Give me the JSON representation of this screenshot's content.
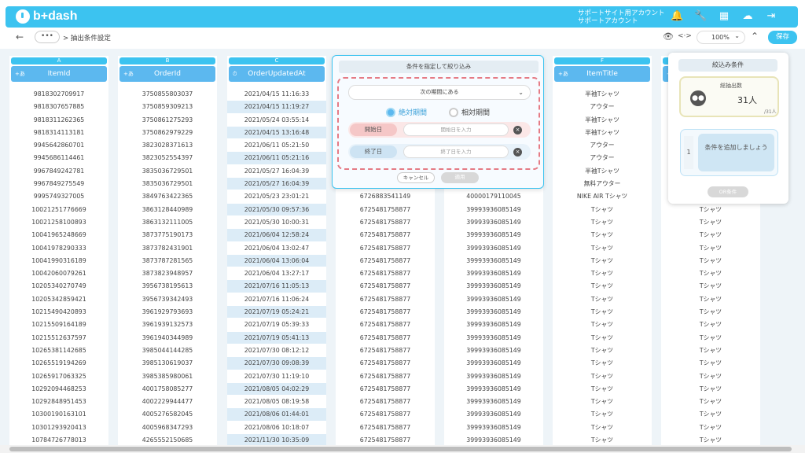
{
  "header": {
    "logo_text": "b+dash",
    "account_line1": "サポートサイト用アカウント",
    "account_line2": "サポートアカウント",
    "icons": [
      "bell-icon",
      "wrench-icon",
      "apps-grid-icon",
      "brain-icon",
      "logout-icon"
    ]
  },
  "toolbar": {
    "back_glyph": "←",
    "dots": "•••",
    "breadcrumb": "> 抽出条件設定",
    "code_glyph": "<·>",
    "zoom": "100%",
    "save_label": "保存"
  },
  "columns": [
    {
      "letter": "A",
      "title": "ItemId",
      "icon": "+あ"
    },
    {
      "letter": "B",
      "title": "OrderId",
      "icon": "+あ"
    },
    {
      "letter": "C",
      "title": "OrderUpdatedAt",
      "icon": "⏱"
    },
    {
      "letter": "",
      "title": "",
      "icon": ""
    },
    {
      "letter": "",
      "title": "",
      "icon": ""
    },
    {
      "letter": "F",
      "title": "ItemTitle",
      "icon": "+あ"
    },
    {
      "letter": "",
      "title": "",
      "icon": "+あ"
    }
  ],
  "rows": {
    "A": [
      "9818302709917",
      "9818307657885",
      "9818311262365",
      "9818314113181",
      "9945642860701",
      "9945686114461",
      "9967849242781",
      "9967849275549",
      "9995749327005",
      "10021251776669",
      "10021258100893",
      "10041965248669",
      "10041978290333",
      "10041990316189",
      "10042060079261",
      "10205340270749",
      "10205342859421",
      "10215490420893",
      "10215509164189",
      "10215512637597",
      "10265381142685",
      "10265519194269",
      "10265917063325",
      "10292094468253",
      "10292848951453",
      "10300190163101",
      "10301293920413",
      "10784726778013"
    ],
    "B": [
      "3750855803037",
      "3750859309213",
      "3750861275293",
      "3750862979229",
      "3823028371613",
      "3823052554397",
      "3835036729501",
      "3835036729501",
      "3849763422365",
      "3863128440989",
      "3863132111005",
      "3873775190173",
      "3873782431901",
      "3873787281565",
      "3873823948957",
      "3956738195613",
      "3956739342493",
      "3961929793693",
      "3961939132573",
      "3961940344989",
      "3985044144285",
      "3985130619037",
      "3985385980061",
      "4001758085277",
      "4002229944477",
      "4005276582045",
      "4005968347293",
      "4265552150685"
    ],
    "C": [
      "2021/04/15 11:16:33",
      "2021/04/15 11:19:27",
      "2021/05/24 03:55:14",
      "2021/04/15 13:16:48",
      "2021/06/11 05:21:50",
      "2021/06/11 05:21:16",
      "2021/05/27 16:04:39",
      "2021/05/27 16:04:39",
      "2021/05/23 23:01:21",
      "2021/05/30 09:57:36",
      "2021/05/30 10:00:31",
      "2021/06/04 12:58:24",
      "2021/06/04 13:02:47",
      "2021/06/04 13:06:04",
      "2021/06/04 13:27:17",
      "2021/07/16 11:05:13",
      "2021/07/16 11:06:24",
      "2021/07/19 05:24:21",
      "2021/07/19 05:39:33",
      "2021/07/19 05:41:13",
      "2021/07/30 08:12:12",
      "2021/07/30 09:08:39",
      "2021/07/30 11:19:10",
      "2021/08/05 04:02:29",
      "2021/08/05 08:19:58",
      "2021/08/06 01:44:01",
      "2021/08/06 10:18:07",
      "2021/11/30 10:35:09"
    ],
    "D": [
      "",
      "",
      "",
      "",
      "",
      "",
      "",
      "",
      "6726883541149",
      "6725481758877",
      "6725481758877",
      "6725481758877",
      "6725481758877",
      "6725481758877",
      "6725481758877",
      "6725481758877",
      "6725481758877",
      "6725481758877",
      "6725481758877",
      "6725481758877",
      "6725481758877",
      "6725481758877",
      "6725481758877",
      "6725481758877",
      "6725481758877",
      "6725481758877",
      "6725481758877",
      "6725481758877"
    ],
    "E": [
      "",
      "",
      "",
      "",
      "",
      "",
      "",
      "",
      "40000179110045",
      "39993936085149",
      "39993936085149",
      "39993936085149",
      "39993936085149",
      "39993936085149",
      "39993936085149",
      "39993936085149",
      "39993936085149",
      "39993936085149",
      "39993936085149",
      "39993936085149",
      "39993936085149",
      "39993936085149",
      "39993936085149",
      "39993936085149",
      "39993936085149",
      "39993936085149",
      "39993936085149",
      "39993936085149"
    ],
    "F": [
      "半袖Tシャツ",
      "アウター",
      "半袖Tシャツ",
      "半袖Tシャツ",
      "アウター",
      "アウター",
      "半袖Tシャツ",
      "無料アウター",
      "NIKE AIR Tシャツ",
      "Tシャツ",
      "Tシャツ",
      "Tシャツ",
      "Tシャツ",
      "Tシャツ",
      "Tシャツ",
      "Tシャツ",
      "Tシャツ",
      "Tシャツ",
      "Tシャツ",
      "Tシャツ",
      "Tシャツ",
      "Tシャツ",
      "Tシャツ",
      "Tシャツ",
      "Tシャツ",
      "Tシャツ",
      "Tシャツ",
      "Tシャツ"
    ],
    "G": [
      "",
      "",
      "",
      "",
      "",
      "",
      "",
      "",
      "",
      "Tシャツ",
      "Tシャツ",
      "Tシャツ",
      "Tシャツ",
      "Tシャツ",
      "Tシャツ",
      "Tシャツ",
      "Tシャツ",
      "Tシャツ",
      "Tシャツ",
      "Tシャツ",
      "Tシャツ",
      "Tシャツ",
      "Tシャツ",
      "Tシャツ",
      "Tシャツ",
      "Tシャツ",
      "Tシャツ",
      "Tシャツ"
    ]
  },
  "filter_popup": {
    "title": "条件を指定して絞り込み",
    "period_select": "次の期間にある",
    "radio_absolute": "絶対期間",
    "radio_relative": "相対期間",
    "start_label": "開始日",
    "start_placeholder": "開始日を入力",
    "end_label": "終了日",
    "end_placeholder": "終了日を入力",
    "cancel": "キャンセル",
    "apply": "適用"
  },
  "side_panel": {
    "title": "絞込み条件",
    "count_label": "総抽出数",
    "count_value": "31人",
    "count_total": "/31人",
    "condition_number": "1",
    "add_condition": "条件を追加しましょう",
    "or_button": "OR条件"
  }
}
